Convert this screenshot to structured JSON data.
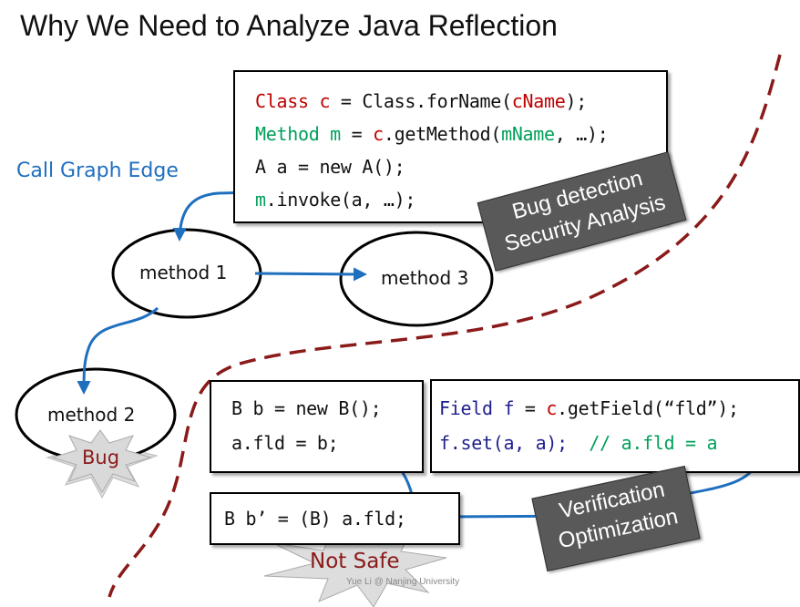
{
  "title": "Why We Need to Analyze Java Reflection",
  "call_graph_label": "Call Graph Edge",
  "colors": {
    "red": "#c00000",
    "green": "#00a05a",
    "navy": "#1f1f8f",
    "blue": "#1f6fbf",
    "dashed_curve": "#8b1a1a",
    "label_bg": "#595959"
  },
  "top_code": [
    [
      {
        "t": "Class c",
        "c": "red"
      },
      {
        "t": " = Class.forName(",
        "c": "black"
      },
      {
        "t": "cName",
        "c": "red"
      },
      {
        "t": ");",
        "c": "black"
      }
    ],
    [
      {
        "t": "Method m",
        "c": "green"
      },
      {
        "t": " = ",
        "c": "black"
      },
      {
        "t": "c",
        "c": "red"
      },
      {
        "t": ".getMethod(",
        "c": "black"
      },
      {
        "t": "mName",
        "c": "green"
      },
      {
        "t": ", …);",
        "c": "black"
      }
    ],
    [
      {
        "t": "A a = new A();",
        "c": "black"
      }
    ],
    [
      {
        "t": "m",
        "c": "green"
      },
      {
        "t": ".invoke(a, …);",
        "c": "black"
      }
    ]
  ],
  "b_code": [
    [
      {
        "t": "B b = new B();",
        "c": "black"
      }
    ],
    [
      {
        "t": "a.fld = b;",
        "c": "black"
      }
    ]
  ],
  "field_code": [
    [
      {
        "t": "Field f",
        "c": "navy"
      },
      {
        "t": " = ",
        "c": "black"
      },
      {
        "t": "c",
        "c": "red"
      },
      {
        "t": ".getField(“fld”);",
        "c": "black"
      }
    ],
    [
      {
        "t": "f.set(a, a);",
        "c": "navy"
      },
      {
        "t": "  // a.fld = a",
        "c": "green"
      }
    ]
  ],
  "cast_code": [
    [
      {
        "t": "B b’ = (B) a.fld;",
        "c": "black"
      }
    ]
  ],
  "nodes": {
    "m1": "method 1",
    "m2": "method 2",
    "m3": "method 3"
  },
  "labels": {
    "bug_detection": "Bug detection",
    "security": "Security Analysis",
    "verification": "Verification",
    "optimization": "Optimization"
  },
  "bursts": {
    "bug": "Bug",
    "not_safe": "Not Safe"
  },
  "watermark": "Yue Li @ Nanjing University"
}
